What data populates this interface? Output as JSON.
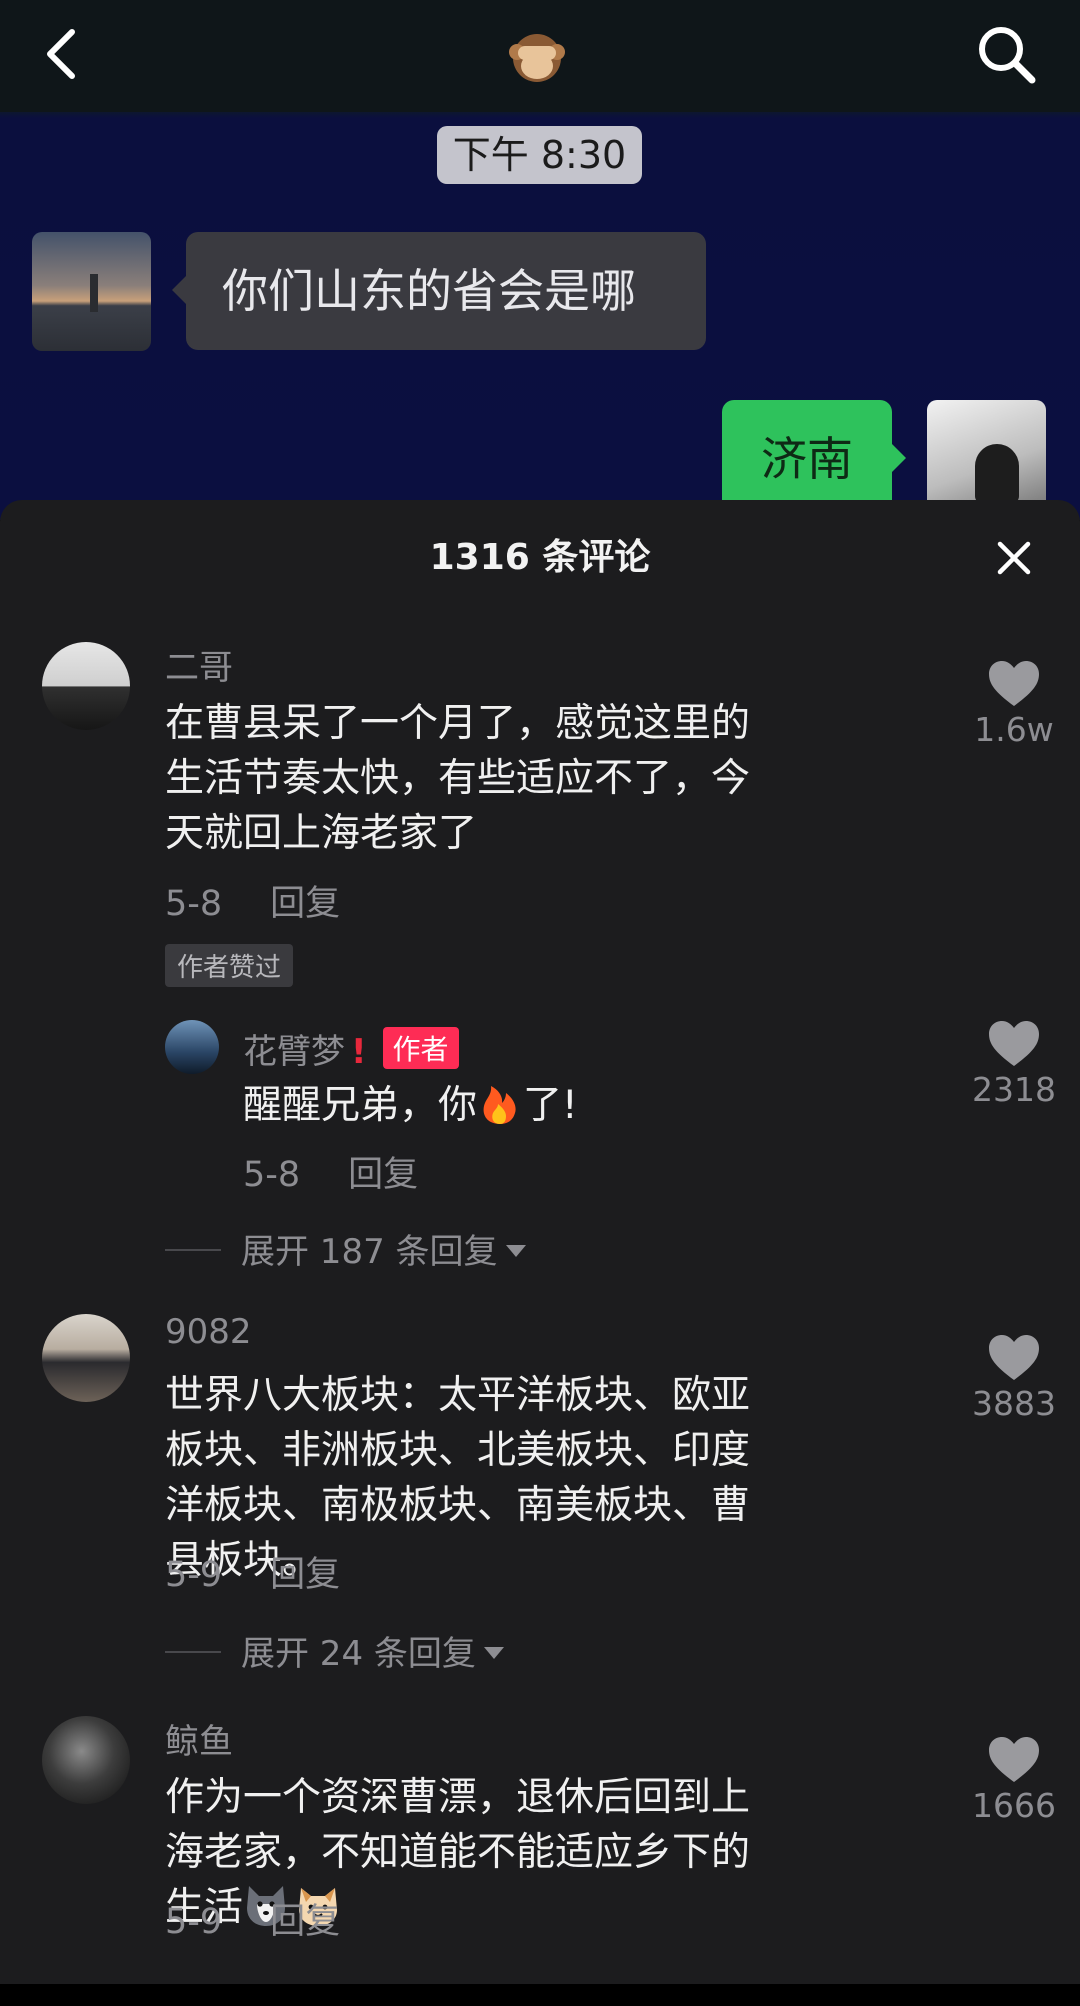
{
  "header": {
    "back_icon": "chevron-left-icon",
    "center_icon": "see-no-evil-monkey-icon",
    "search_icon": "search-icon"
  },
  "chat": {
    "time": "下午 8:30",
    "left_message": "你们山东的省会是哪",
    "right_message": "济南"
  },
  "comments_sheet": {
    "title": "1316 条评论",
    "close_icon": "close-icon",
    "comments": [
      {
        "user": "二哥",
        "text": "在曹县呆了一个月了，感觉这里的生活节奏太快，有些适应不了，今天就回上海老家了",
        "date": "5-8",
        "reply_label": "回复",
        "likes": "1.6w",
        "badge": "作者赞过",
        "reply": {
          "user": "花臂梦",
          "author_badge": "作者",
          "text_before": "醒醒兄弟，你",
          "text_after": "了!",
          "emoji": "fire-emoji",
          "date": "5-8",
          "reply_label": "回复",
          "likes": "2318"
        },
        "expand": "展开 187 条回复"
      },
      {
        "user": "9082",
        "text": "世界八大板块：太平洋板块、欧亚板块、非洲板块、北美板块、印度洋板块、南极板块、南美板块、曹县板块。",
        "date": "5-9",
        "reply_label": "回复",
        "likes": "3883",
        "expand": "展开 24 条回复"
      },
      {
        "user": "鲸鱼",
        "text": "作为一个资深曹漂，退休后回到上海老家，不知道能不能适应乡下的生活",
        "emojis": [
          "husky-emoji",
          "cat-emoji"
        ],
        "date": "5-9",
        "reply_label": "回复",
        "likes": "1666"
      }
    ]
  },
  "colors": {
    "sheet_bg": "#1c1c1e",
    "accent_author": "#fe2c55",
    "muted_text": "#8d8d92",
    "chat_green": "#2ec25c"
  }
}
